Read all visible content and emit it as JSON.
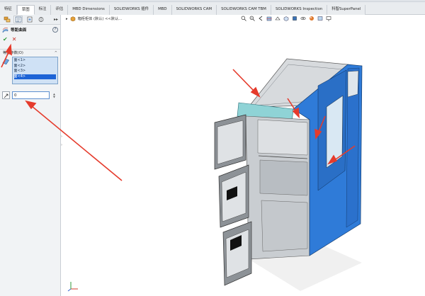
{
  "tabs": [
    {
      "label": "特征",
      "active": false
    },
    {
      "label": "草图",
      "active": true
    },
    {
      "label": "标注",
      "active": false
    },
    {
      "label": "评估",
      "active": false
    },
    {
      "label": "MBD Dimensions",
      "active": false
    },
    {
      "label": "SOLIDWORKS 插件",
      "active": false
    },
    {
      "label": "MBD",
      "active": false
    },
    {
      "label": "SOLIDWORKS CAM",
      "active": false
    },
    {
      "label": "SOLIDWORKS CAM TBM",
      "active": false
    },
    {
      "label": "SOLIDWORKS Inspection",
      "active": false
    },
    {
      "label": "科智SuperPanel",
      "active": false
    }
  ],
  "property_manager": {
    "feature_title": "等距曲面",
    "help_label": "?",
    "ok_glyph": "✔",
    "cancel_glyph": "✕",
    "group_title": "等距参数(O)",
    "collapse_glyph": "^",
    "faces": [
      {
        "label": "面<1>",
        "selected": false
      },
      {
        "label": "面<2>",
        "selected": false
      },
      {
        "label": "面<3>",
        "selected": false
      },
      {
        "label": "面<4>",
        "selected": true
      }
    ],
    "offset_value": "0",
    "spin_up": "▲",
    "spin_down": "▼"
  },
  "viewport": {
    "breadcrumb_arrow": "▸",
    "breadcrumb_text": "箱柜柜体 (默认) <<默认..."
  },
  "colors": {
    "selection_blue": "#2f7bd8",
    "highlight_cyan": "#8fd3d6",
    "arrow_red": "#e53b2c",
    "list_highlight": "#1c63d6"
  }
}
